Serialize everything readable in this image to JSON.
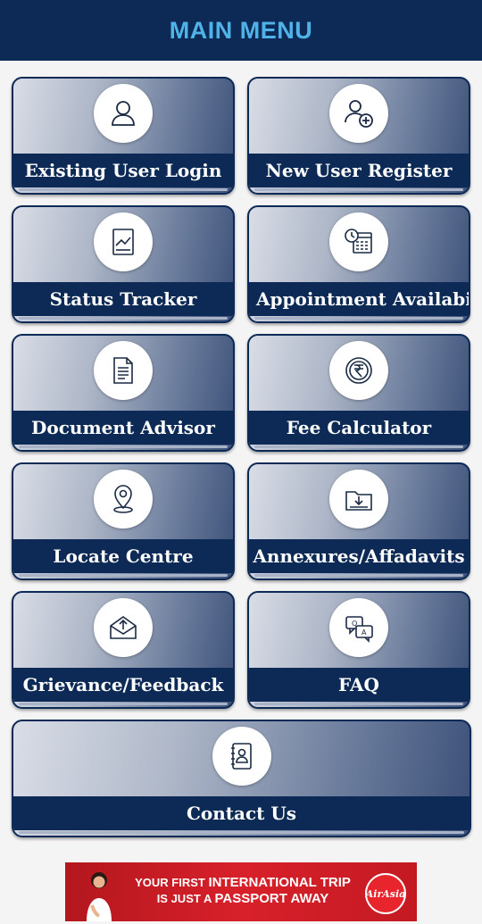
{
  "header": {
    "title": "MAIN MENU"
  },
  "menu": {
    "existing_user_login": "Existing User Login",
    "new_user_register": "New User Register",
    "status_tracker": "Status Tracker",
    "appointment_availability": "Appointment Availabi",
    "document_advisor": "Document Advisor",
    "fee_calculator": "Fee Calculator",
    "locate_centre": "Locate Centre",
    "annexures_affadavits": "Annexures/Affadavits",
    "grievance_feedback": "Grievance/Feedback",
    "faq": "FAQ",
    "contact_us": "Contact Us"
  },
  "icons": {
    "existing_user_login": "user-icon",
    "new_user_register": "add-user-icon",
    "status_tracker": "chart-document-icon",
    "appointment_availability": "calendar-clock-icon",
    "document_advisor": "document-icon",
    "fee_calculator": "rupee-coin-icon",
    "locate_centre": "location-pin-icon",
    "annexures_affadavits": "download-folder-icon",
    "grievance_feedback": "upload-mail-icon",
    "faq": "qa-chat-icon",
    "contact_us": "contact-book-icon"
  },
  "ad": {
    "line1_small": "YOUR FIRST",
    "line1_big": "INTERNATIONAL TRIP",
    "line2_small": "IS JUST A",
    "line2_big": "PASSPORT AWAY",
    "brand": "AirAsia"
  },
  "colors": {
    "header_bg": "#0c2a55",
    "header_text": "#4fb3e8",
    "label_bar": "#0c2a55",
    "ad_bg": "#d8202a"
  }
}
